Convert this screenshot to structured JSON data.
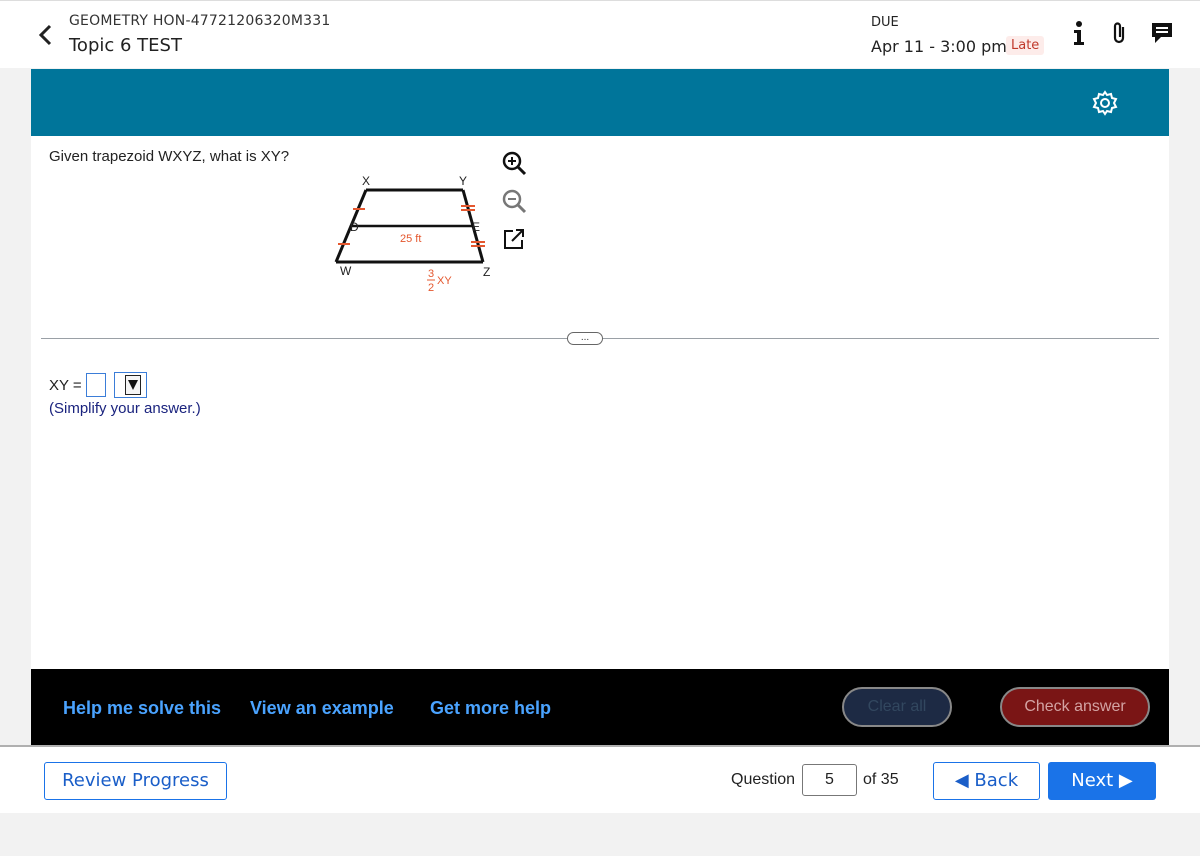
{
  "header": {
    "course": "GEOMETRY HON-47721206320M331",
    "test_name": "Topic 6 TEST",
    "due_label": "DUE",
    "due_date": "Apr 11 - 3:00 pm",
    "late_badge": "Late"
  },
  "question": {
    "prompt": "Given trapezoid WXYZ, what is XY?",
    "figure": {
      "labels": {
        "X": "X",
        "Y": "Y",
        "D": "D",
        "E": "E",
        "W": "W",
        "Z": "Z"
      },
      "midsegment": "25 ft",
      "base_numerator": "3",
      "base_denominator": "2",
      "base_suffix": "XY"
    },
    "more_label": "..."
  },
  "answer": {
    "label": "XY =",
    "hint": "(Simplify your answer.)"
  },
  "help": {
    "help_me": "Help me solve this",
    "example": "View an example",
    "more_help": "Get more help",
    "clear_all": "Clear all",
    "check_answer": "Check answer"
  },
  "footer": {
    "review": "Review Progress",
    "question_label": "Question",
    "question_number": "5",
    "of_total": "of 35",
    "back": "◀ Back",
    "next": "Next ▶"
  },
  "colors": {
    "banner": "#00759a",
    "link": "#4aa3ff",
    "primary": "#1a73e8",
    "tick": "#e4572e"
  }
}
